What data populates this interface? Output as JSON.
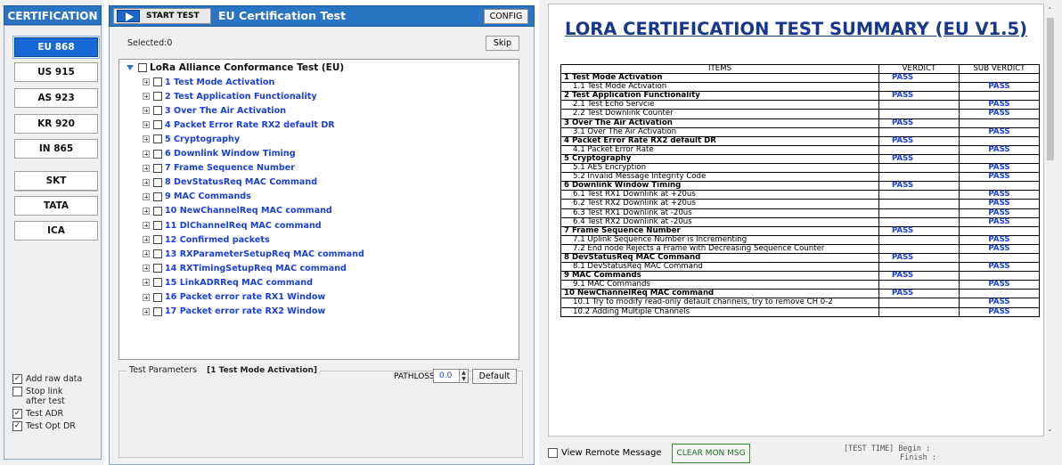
{
  "sidebar": {
    "title": "CERTIFICATION",
    "regions": [
      "EU 868",
      "US 915",
      "AS 923",
      "KR 920",
      "IN 865"
    ],
    "active_region": "EU 868",
    "operators": [
      "SKT",
      "TATA",
      "ICA"
    ],
    "options": [
      {
        "label": "Add raw data",
        "checked": true
      },
      {
        "label": "Stop link after test",
        "checked": false
      },
      {
        "label": "Test ADR",
        "checked": true
      },
      {
        "label": "Test Opt DR",
        "checked": true
      }
    ]
  },
  "main": {
    "start_label": "START TEST",
    "title": "EU Certification Test",
    "config_label": "CONFIG",
    "selected": "Selected:0",
    "skip_label": "Skip",
    "tree_root": "LoRa Alliance Conformance Test (EU)",
    "tests": [
      "1 Test Mode Activation",
      "2 Test Application Functionality",
      "3 Over The Air Activation",
      "4 Packet Error Rate RX2 default DR",
      "5 Cryptography",
      "6 Downlink Window Timing",
      "7 Frame Sequence Number",
      "8 DevStatusReq MAC Command",
      "9 MAC Commands",
      "10 NewChannelReq MAC command",
      "11 DlChannelReq MAC command",
      "12 Confirmed packets",
      "13 RXParameterSetupReq MAC command",
      "14 RXTimingSetupReq MAC command",
      "15 LinkADRReq MAC command",
      "16 Packet error rate RX1 Window",
      "17 Packet error rate RX2 Window"
    ],
    "params_label": "Test Parameters",
    "params_current": "[1 Test Mode Activation]",
    "pathloss_label": "PATHLOSS",
    "pathloss_value": "0.0",
    "default_label": "Default"
  },
  "report": {
    "title": "LORA CERTIFICATION TEST SUMMARY (EU V1.5)",
    "columns": [
      "ITEMS",
      "VERDICT",
      "SUB VERDICT"
    ],
    "rows": [
      {
        "type": "group",
        "item": "1 Test Mode Activation",
        "verdict": "PASS",
        "sub": ""
      },
      {
        "type": "sub",
        "item": "1.1 Test Mode Activation",
        "verdict": "",
        "sub": "PASS"
      },
      {
        "type": "group",
        "item": "2 Test Application Functionality",
        "verdict": "PASS",
        "sub": ""
      },
      {
        "type": "sub",
        "item": "2.1 Test Echo Servcie",
        "verdict": "",
        "sub": "PASS"
      },
      {
        "type": "sub",
        "item": "2.2 Test Downlink Counter",
        "verdict": "",
        "sub": "PASS"
      },
      {
        "type": "group",
        "item": "3 Over The Air Activation",
        "verdict": "PASS",
        "sub": ""
      },
      {
        "type": "sub",
        "item": "3.1 Over The Air Activation",
        "verdict": "",
        "sub": "PASS"
      },
      {
        "type": "group",
        "item": "4 Packet Error Rate RX2 default DR",
        "verdict": "PASS",
        "sub": ""
      },
      {
        "type": "sub",
        "item": "4.1 Packet Error Rate",
        "verdict": "",
        "sub": "PASS"
      },
      {
        "type": "group",
        "item": "5 Cryptography",
        "verdict": "PASS",
        "sub": ""
      },
      {
        "type": "sub",
        "item": "5.1 AES Encryption",
        "verdict": "",
        "sub": "PASS"
      },
      {
        "type": "sub",
        "item": "5.2 Invalid Message Integrity Code",
        "verdict": "",
        "sub": "PASS"
      },
      {
        "type": "group",
        "item": "6 Downlink Window Timing",
        "verdict": "PASS",
        "sub": ""
      },
      {
        "type": "sub",
        "item": "6.1 Test RX1 Downlink at +20us",
        "verdict": "",
        "sub": "PASS"
      },
      {
        "type": "sub",
        "item": "6.2 Test RX2 Downlink at +20us",
        "verdict": "",
        "sub": "PASS"
      },
      {
        "type": "sub",
        "item": "6.3 Test RX1 Downlink at -20us",
        "verdict": "",
        "sub": "PASS"
      },
      {
        "type": "sub",
        "item": "6.4 Test RX2 Downlink at -20us",
        "verdict": "",
        "sub": "PASS"
      },
      {
        "type": "group",
        "item": "7 Frame Sequence Number",
        "verdict": "PASS",
        "sub": ""
      },
      {
        "type": "sub",
        "item": "7.1 Uplink Sequence Number is Incrementing",
        "verdict": "",
        "sub": "PASS"
      },
      {
        "type": "sub",
        "item": "7.2 End node Rejects a Frame with Decreasing Sequence Counter",
        "verdict": "",
        "sub": "PASS"
      },
      {
        "type": "group",
        "item": "8 DevStatusReq MAC Command",
        "verdict": "PASS",
        "sub": ""
      },
      {
        "type": "sub",
        "item": "8.1 DevStatusReq MAC Command",
        "verdict": "",
        "sub": "PASS"
      },
      {
        "type": "group",
        "item": "9 MAC Commands",
        "verdict": "PASS",
        "sub": ""
      },
      {
        "type": "sub",
        "item": "9.1 MAC Commands",
        "verdict": "",
        "sub": "PASS"
      },
      {
        "type": "group",
        "item": "10 NewChannelReq MAC command",
        "verdict": "PASS",
        "sub": ""
      },
      {
        "type": "sub",
        "item": "10.1 Try to modify read-only default channels, try to remove CH 0-2",
        "verdict": "",
        "sub": "PASS"
      },
      {
        "type": "sub",
        "item": "10.2 Adding Multiple Channels",
        "verdict": "",
        "sub": "PASS"
      }
    ]
  },
  "footer": {
    "remote_label": "View Remote Message",
    "clear_label": "CLEAR MON MSG",
    "test_time_begin": "[TEST TIME] Begin  :",
    "test_time_finish": "Finish :"
  },
  "colors": {
    "accent": "#2a74c4",
    "active_region": "#1769d8",
    "pass": "#1a3fd8",
    "report_title": "#17378d"
  }
}
